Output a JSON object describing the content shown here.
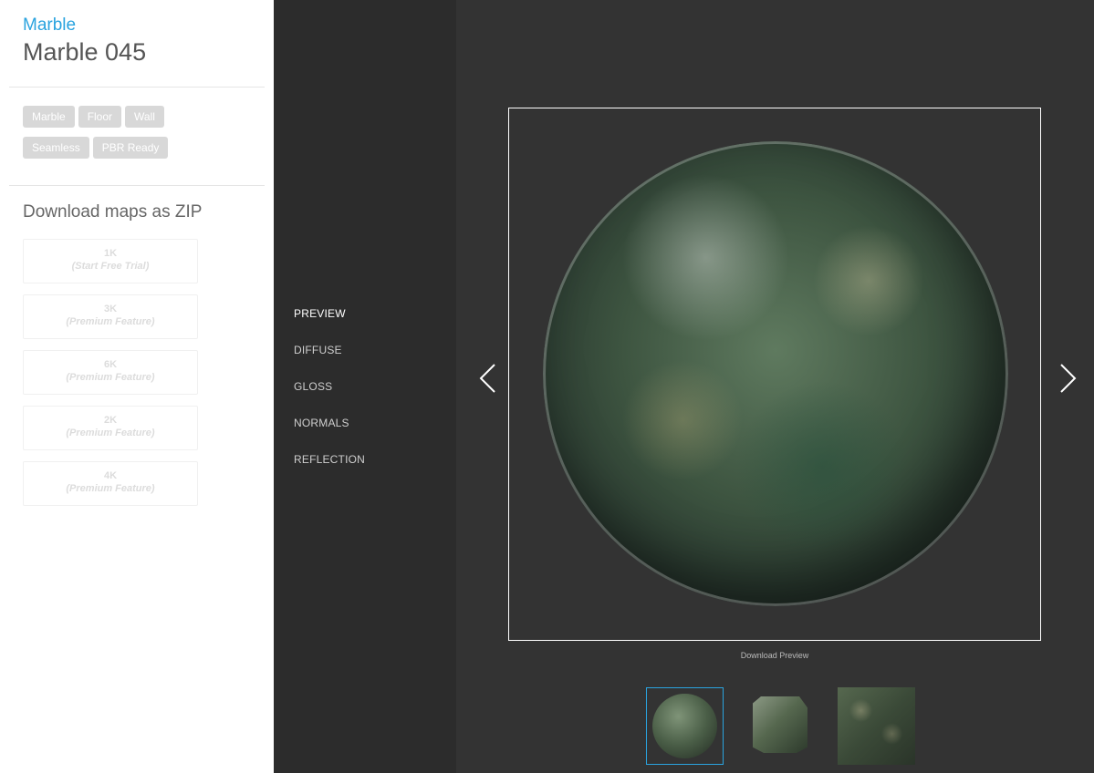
{
  "header": {
    "category": "Marble",
    "title": "Marble 045"
  },
  "tags": [
    "Marble",
    "Floor",
    "Wall",
    "Seamless",
    "PBR Ready"
  ],
  "download": {
    "heading": "Download maps as ZIP",
    "options": [
      {
        "resolution": "1K",
        "note": "(Start Free Trial)"
      },
      {
        "resolution": "3K",
        "note": "(Premium Feature)"
      },
      {
        "resolution": "6K",
        "note": "(Premium Feature)"
      },
      {
        "resolution": "2K",
        "note": "(Premium Feature)"
      },
      {
        "resolution": "4K",
        "note": "(Premium Feature)"
      }
    ]
  },
  "maps": {
    "active": "PREVIEW",
    "items": [
      "PREVIEW",
      "DIFFUSE",
      "GLOSS",
      "NORMALS",
      "REFLECTION"
    ]
  },
  "viewer": {
    "download_preview_label": "Download Preview",
    "thumbnails": [
      {
        "name": "sphere",
        "selected": true
      },
      {
        "name": "cube",
        "selected": false
      },
      {
        "name": "flat",
        "selected": false
      }
    ]
  },
  "colors": {
    "accent": "#2aa3df",
    "sidebar_bg": "#ffffff",
    "nav_bg": "#2c2c2c",
    "viewer_bg": "#333333",
    "tag_bg": "#d8d8d8"
  }
}
